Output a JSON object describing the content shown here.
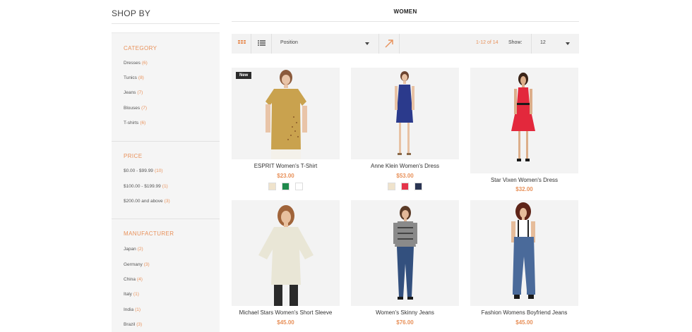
{
  "sidebar": {
    "heading": "SHOP BY",
    "groups": [
      {
        "title": "CATEGORY",
        "items": [
          {
            "label": "Dresses",
            "count": "(6)"
          },
          {
            "label": "Tunics",
            "count": "(8)"
          },
          {
            "label": "Jeans",
            "count": "(7)"
          },
          {
            "label": "Blouses",
            "count": "(7)"
          },
          {
            "label": "T-shirts",
            "count": "(6)"
          }
        ]
      },
      {
        "title": "PRICE",
        "items": [
          {
            "label": "$0.00 - $99.99",
            "count": "(10)"
          },
          {
            "label": "$100.00 - $199.99",
            "count": "(1)"
          },
          {
            "label": "$200.00 and above",
            "count": "(3)"
          }
        ]
      },
      {
        "title": "MANUFACTURER",
        "items": [
          {
            "label": "Japan",
            "count": "(2)"
          },
          {
            "label": "Germany",
            "count": "(3)"
          },
          {
            "label": "China",
            "count": "(4)"
          },
          {
            "label": "Italy",
            "count": "(1)"
          },
          {
            "label": "India",
            "count": "(1)"
          },
          {
            "label": "Brazil",
            "count": "(3)"
          }
        ]
      }
    ]
  },
  "main": {
    "title": "WOMEN",
    "toolbar": {
      "sort_by": "Position",
      "count_text": "1-12 of 14",
      "show_label": "Show:",
      "limit": "12",
      "grid_icon": "grid-view-icon",
      "list_icon": "list-view-icon",
      "direction_icon": "sort-direction-arrow-icon"
    }
  },
  "products": [
    {
      "name": "ESPRIT Women's T-Shirt",
      "price": "$23.00",
      "badge": "New",
      "swatches": [
        "#efe3cc",
        "#1f8a4c",
        "#ffffff"
      ]
    },
    {
      "name": "Anne Klein Women's Dress",
      "price": "$53.00",
      "swatches": [
        "#efe3cc",
        "#e5344a",
        "#2b3553"
      ]
    },
    {
      "name": "Star Vixen Women's Dress",
      "price": "$32.00",
      "swatches": []
    },
    {
      "name": "Michael Stars Women's Short Sleeve",
      "price": "$45.00",
      "swatches": []
    },
    {
      "name": "Women's Skinny Jeans",
      "price": "$76.00",
      "swatches": []
    },
    {
      "name": "Fashion Womens Boyfriend Jeans",
      "price": "$45.00",
      "swatches": []
    }
  ],
  "colors": {
    "accent": "#e8915a",
    "panel": "#f5f5f5",
    "toolbar": "#f2f2f2",
    "badge": "#2b2b2b"
  }
}
